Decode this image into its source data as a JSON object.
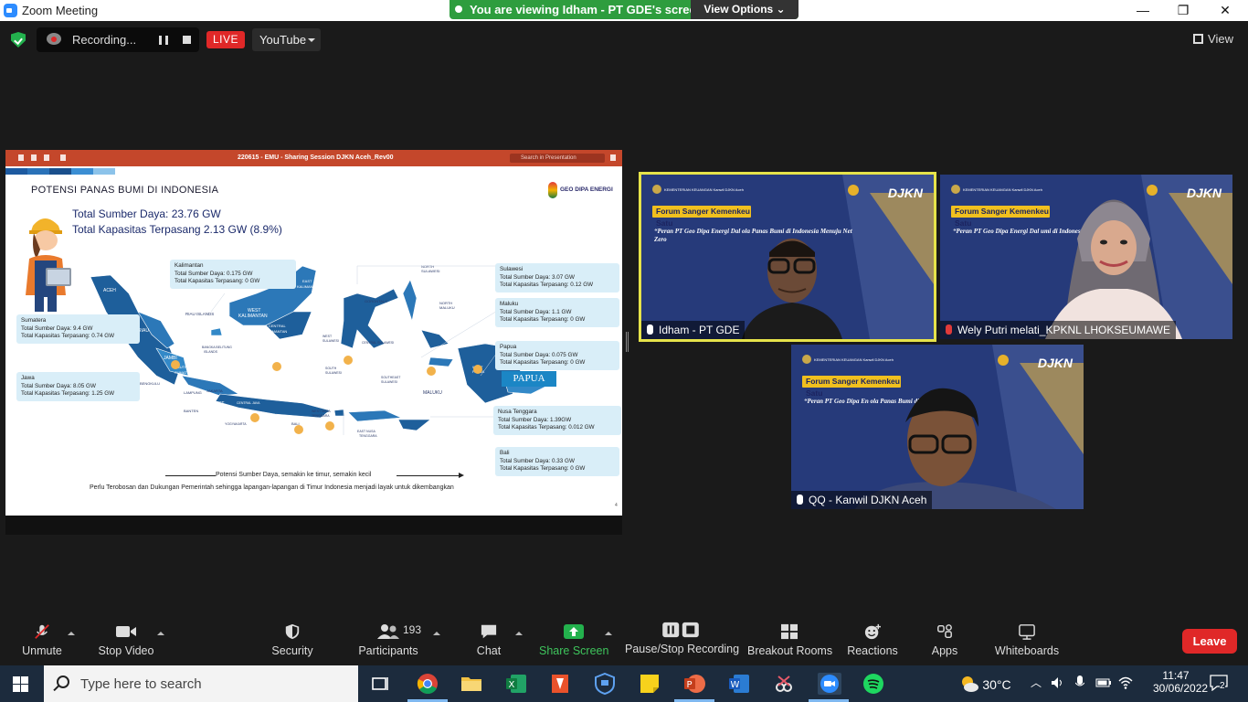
{
  "window": {
    "title": "Zoom Meeting",
    "minimize": "—",
    "restore": "❐",
    "close": "✕"
  },
  "banner": {
    "viewing": "You are viewing Idham - PT GDE's screen",
    "view_options": "View Options ⌄"
  },
  "topbar": {
    "recording": "Recording...",
    "live": "LIVE",
    "stream_target": "YouTube",
    "view": "View"
  },
  "ppt": {
    "doc_title": "220615 - EMU - Sharing Session DJKN Aceh_Rev00",
    "search_placeholder": "Search in Presentation"
  },
  "slide": {
    "title": "POTENSI PANAS BUMI DI INDONESIA",
    "logo_text": "GEO DIPA ENERGI",
    "total_resource": "Total Sumber Daya: 23.76 GW",
    "total_installed": "Total Kapasitas Terpasang 2.13 GW (8.9%)",
    "callouts": [
      {
        "name": "Kalimantan",
        "l1": "Total Sumber Daya: 0.175 GW",
        "l2": "Total Kapasitas Terpasang: 0 GW"
      },
      {
        "name": "Sumatera",
        "l1": "Total Sumber Daya: 9.4 GW",
        "l2": "Total Kapasitas Terpasang: 0.74 GW"
      },
      {
        "name": "Jawa",
        "l1": "Total Sumber Daya: 8.05 GW",
        "l2": "Total Kapasitas Terpasang: 1.25 GW"
      },
      {
        "name": "Sulawesi",
        "l1": "Total Sumber Daya: 3.07 GW",
        "l2": "Total Kapasitas Terpasang: 0.12 GW"
      },
      {
        "name": "Maluku",
        "l1": "Total Sumber Daya: 1.1 GW",
        "l2": "Total Kapasitas Terpasang: 0 GW"
      },
      {
        "name": "Papua",
        "l1": "Total Sumber Daya: 0.075 GW",
        "l2": "Total Kapasitas Terpasang: 0 GW"
      },
      {
        "name": "Nusa Tenggara",
        "l1": "Total Sumber Daya: 1.39GW",
        "l2": "Total Kapasitas Terpasang: 0.012 GW"
      },
      {
        "name": "Bali",
        "l1": "Total Sumber Daya: 0.33 GW",
        "l2": "Total Kapasitas Terpasang: 0 GW"
      }
    ],
    "map_labels": {
      "aceh": "ACEH",
      "riau_islands": "RIAU ISLANDS",
      "riau": "RIAU",
      "jambi": "JAMBI",
      "south_sumatra": "SOUTH SUMATRA",
      "bengkulu": "BENGKULU",
      "lampung": "LAMPUNG",
      "bangka": "BANGKA BELITUNG ISLANDS",
      "jakarta": "JAKARTA",
      "banten": "BANTEN",
      "west_java": "WEST JAVA",
      "central_java": "CENTRAL JAVA",
      "yogyakarta": "YOGYAKARTA",
      "bali": "BALI",
      "west_kalimantan": "WEST KALIMANTAN",
      "central_kalimantan": "CENTRAL KALIMANTAN",
      "east_kalimantan": "EAST KALIMANTAN",
      "west_sulawesi": "WEST SULAWESI",
      "central_sulawesi": "CENTRAL SULAWESI",
      "gorontalo": "GORONTALO",
      "north_sulawesi": "NORTH SULAWESI",
      "north_maluku": "NORTH MALUKU",
      "maluku": "MALUKU",
      "west_papua": "WEST PAPUA",
      "west_nusa": "WEST NUSA TENGGARA",
      "east_nusa": "EAST NUSA TENGGARA",
      "south_sulawesi": "SOUTH SULAWESI",
      "southeast_sulawesi": "SOUTHEAST SULAWESI",
      "papua": "PAPUA"
    },
    "arrow_text": "Potensi Sumber Daya, semakin ke timur, semakin kecil",
    "note": "Perlu Terobosan dan Dukungan Pemerintah sehingga lapangan-lapangan di Timur Indonesia menjadi layak untuk dikembangkan",
    "page_number": "4"
  },
  "tiles": [
    {
      "name": "Idham - PT GDE",
      "banner": "Forum Sanger Kemenkeu Satu",
      "quote": "“Peran PT Geo Dipa Energi Dal          ola Panas Bumi di Indonesia Menuju Net Zero",
      "brand": "DJKN",
      "org": "KEMENTERIAN KEUANGAN Kanwil DJKN Aceh"
    },
    {
      "name": "Wely Putri melati_KPKNL LHOKSEUMAWE",
      "banner": "Forum Sanger Kemenkeu Satu",
      "quote": "“Peran PT Geo Dipa Energi Dal          umi di Indonesia Menuju Net Zero",
      "brand": "DJKN",
      "org": "KEMENTERIAN KEUANGAN Kanwil DJKN Aceh"
    },
    {
      "name": "QQ - Kanwil DJKN Aceh",
      "banner": "Forum Sanger Kemenkeu Satu",
      "quote": "“Peran PT Geo Dipa En          ola Panas Bumi di Indonesia Menuju",
      "brand": "DJKN",
      "org": "KEMENTERIAN KEUANGAN Kanwil DJKN Aceh"
    }
  ],
  "toolbar": {
    "unmute": "Unmute",
    "stop_video": "Stop Video",
    "security": "Security",
    "participants": "Participants",
    "participants_count": "193",
    "chat": "Chat",
    "share_screen": "Share Screen",
    "pause_stop_recording": "Pause/Stop Recording",
    "breakout_rooms": "Breakout Rooms",
    "reactions": "Reactions",
    "apps": "Apps",
    "whiteboards": "Whiteboards",
    "leave": "Leave"
  },
  "taskbar": {
    "search_placeholder": "Type here to search",
    "temperature": "30°C",
    "time": "11:47",
    "date": "30/06/2022",
    "notifications": "2"
  },
  "colors": {
    "accent": "#2d8cff",
    "live": "#e02828",
    "share_green": "#2e9d3e",
    "active_speaker": "#e6e34a",
    "map_blue": "#1e5f9b"
  }
}
